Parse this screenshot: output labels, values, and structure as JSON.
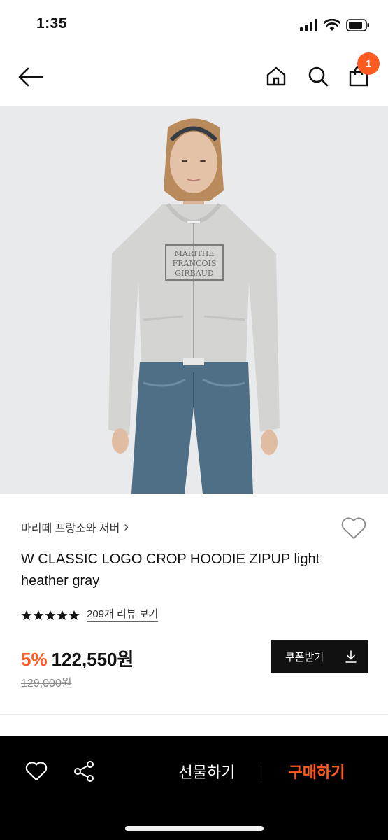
{
  "status_bar": {
    "time": "1:35"
  },
  "header": {
    "cart_count": "1",
    "icons": [
      "back-arrow-icon",
      "home-icon",
      "search-icon",
      "shopping-bag-icon"
    ]
  },
  "product": {
    "brand": "마리떼 프랑소와 저버",
    "brand_chevron": "›",
    "title": "W CLASSIC LOGO CROP HOODIE ZIPUP light heather gray",
    "rating_stars": 5,
    "review_link": "209개 리뷰 보기",
    "discount": "5%",
    "price": "122,550원",
    "original_price": "129,000원",
    "coupon_button": "쿠폰받기",
    "image_logo_text": "MARITHE FRANCOIS GIRBAUD"
  },
  "bottom_bar": {
    "gift_label": "선물하기",
    "buy_label": "구매하기"
  },
  "colors": {
    "accent": "#ff5a1f",
    "dark": "#111111",
    "bottom_bar": "#000000",
    "image_bg": "#e9eaec"
  }
}
